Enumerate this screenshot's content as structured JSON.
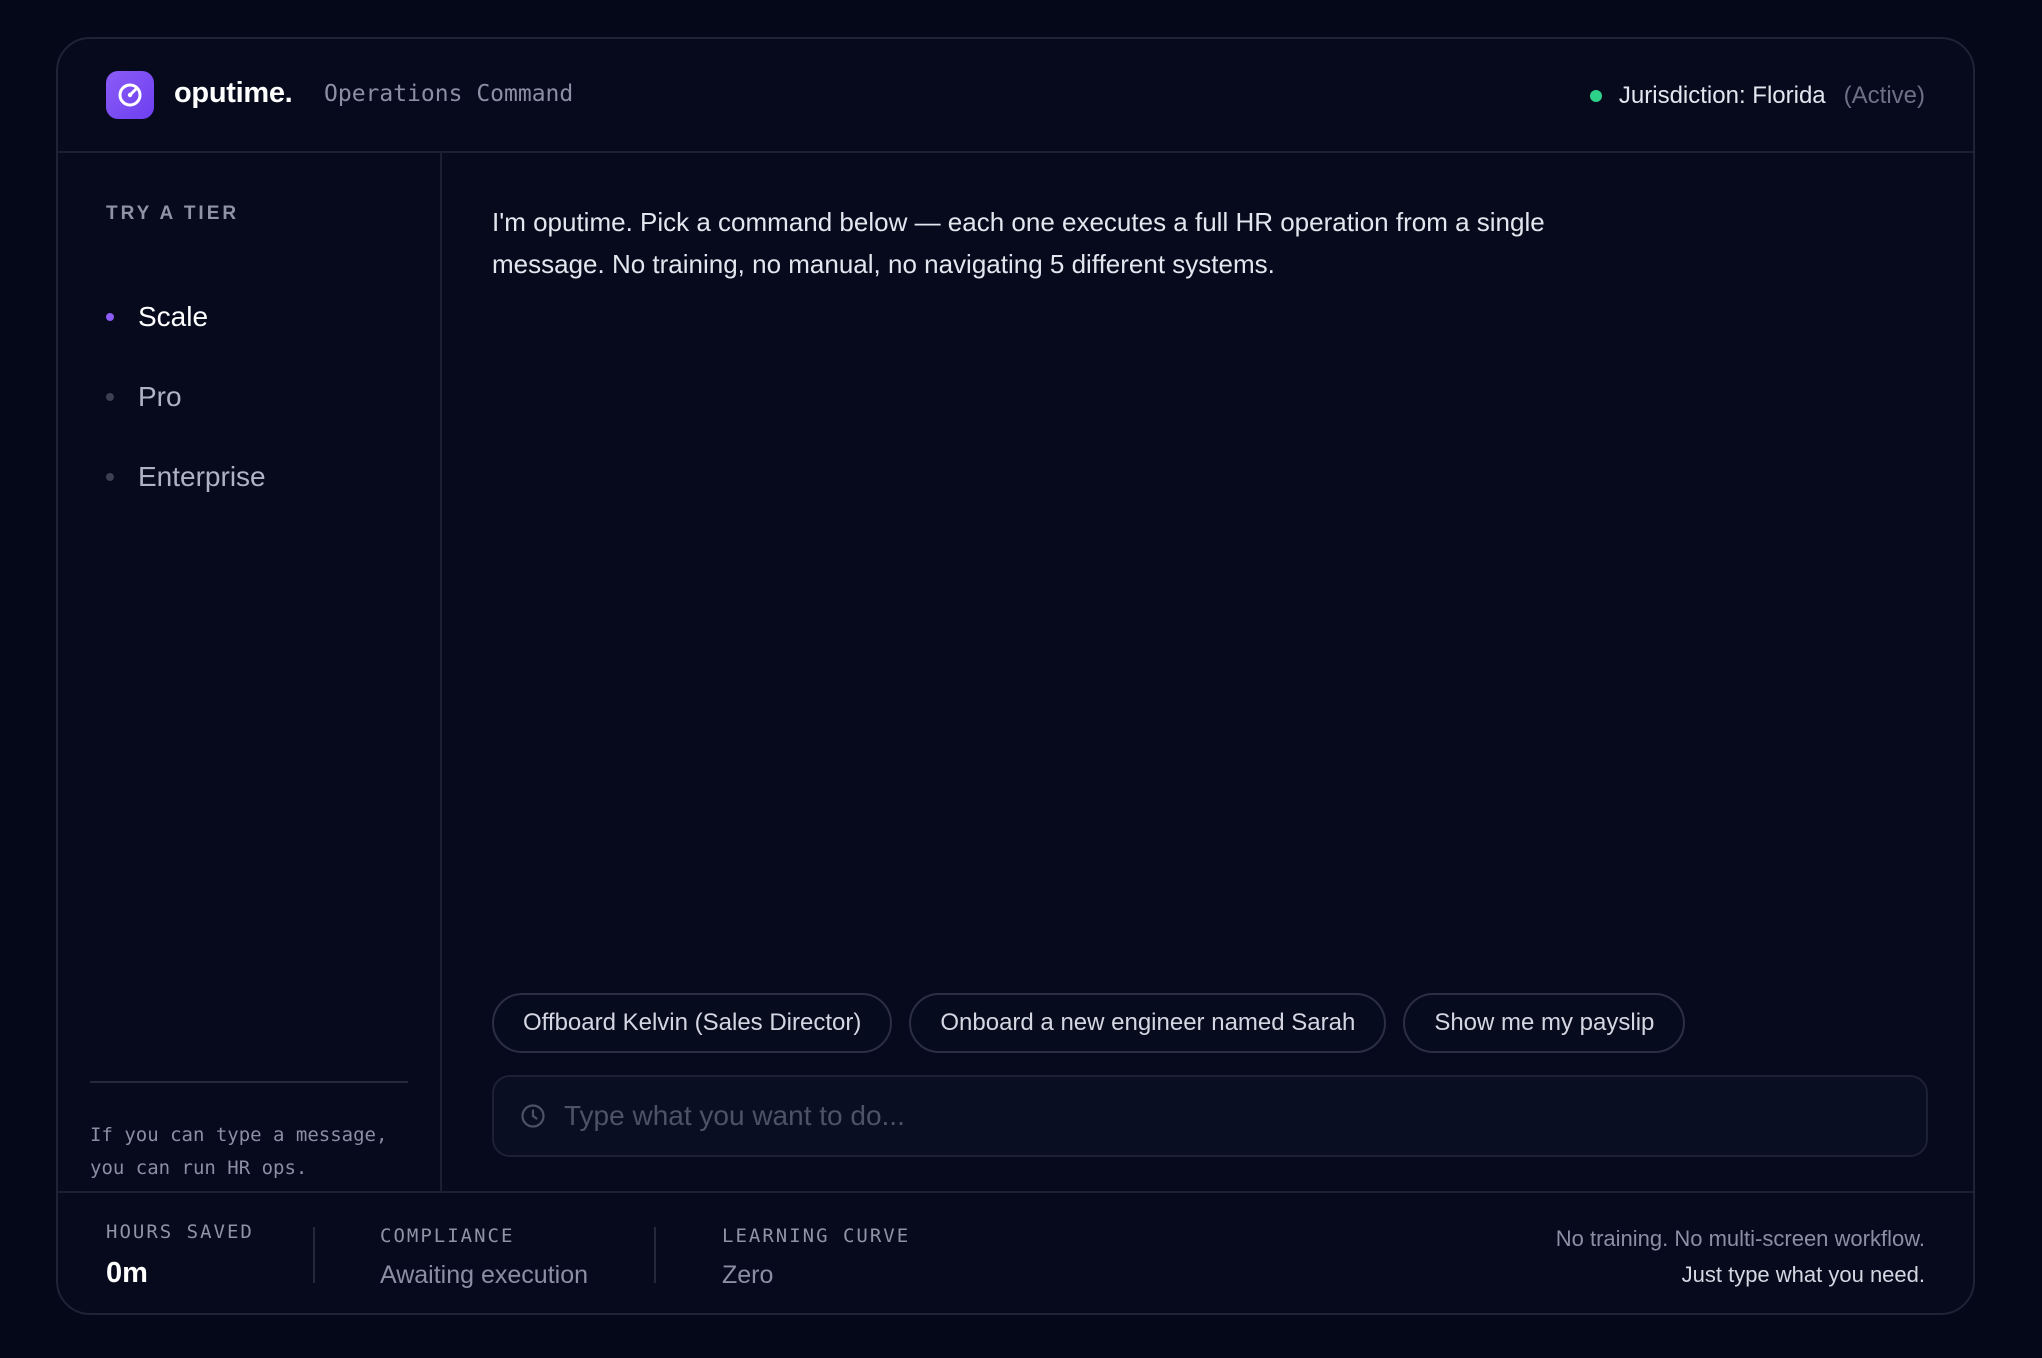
{
  "header": {
    "brand": "oputime.",
    "subtitle": "Operations Command",
    "jurisdiction_label": "Jurisdiction: Florida",
    "jurisdiction_state": "(Active)",
    "status_color": "#2ed18a"
  },
  "sidebar": {
    "title": "TRY A TIER",
    "tiers": [
      {
        "label": "Scale",
        "active": true
      },
      {
        "label": "Pro",
        "active": false
      },
      {
        "label": "Enterprise",
        "active": false
      }
    ],
    "note": "If you can type a message, you can run HR ops."
  },
  "main": {
    "intro": "I'm oputime. Pick a command below — each one executes a full HR operation from a single message. No training, no manual, no navigating 5 different systems.",
    "suggestions": [
      "Offboard Kelvin (Sales Director)",
      "Onboard a new engineer named Sarah",
      "Show me my payslip"
    ],
    "input": {
      "placeholder": "Type what you want to do...",
      "value": ""
    }
  },
  "footer": {
    "stats": [
      {
        "label": "HOURS SAVED",
        "value": "0m"
      },
      {
        "label": "COMPLIANCE",
        "value": "Awaiting execution"
      },
      {
        "label": "LEARNING CURVE",
        "value": "Zero"
      }
    ],
    "tagline_line1": "No training. No multi-screen workflow.",
    "tagline_line2": "Just type what you need."
  },
  "icons": {
    "logo": "logo-icon",
    "status": "status-dot-icon",
    "input": "clock-icon"
  },
  "colors": {
    "accent": "#8b5cf6",
    "background": "#050818"
  }
}
